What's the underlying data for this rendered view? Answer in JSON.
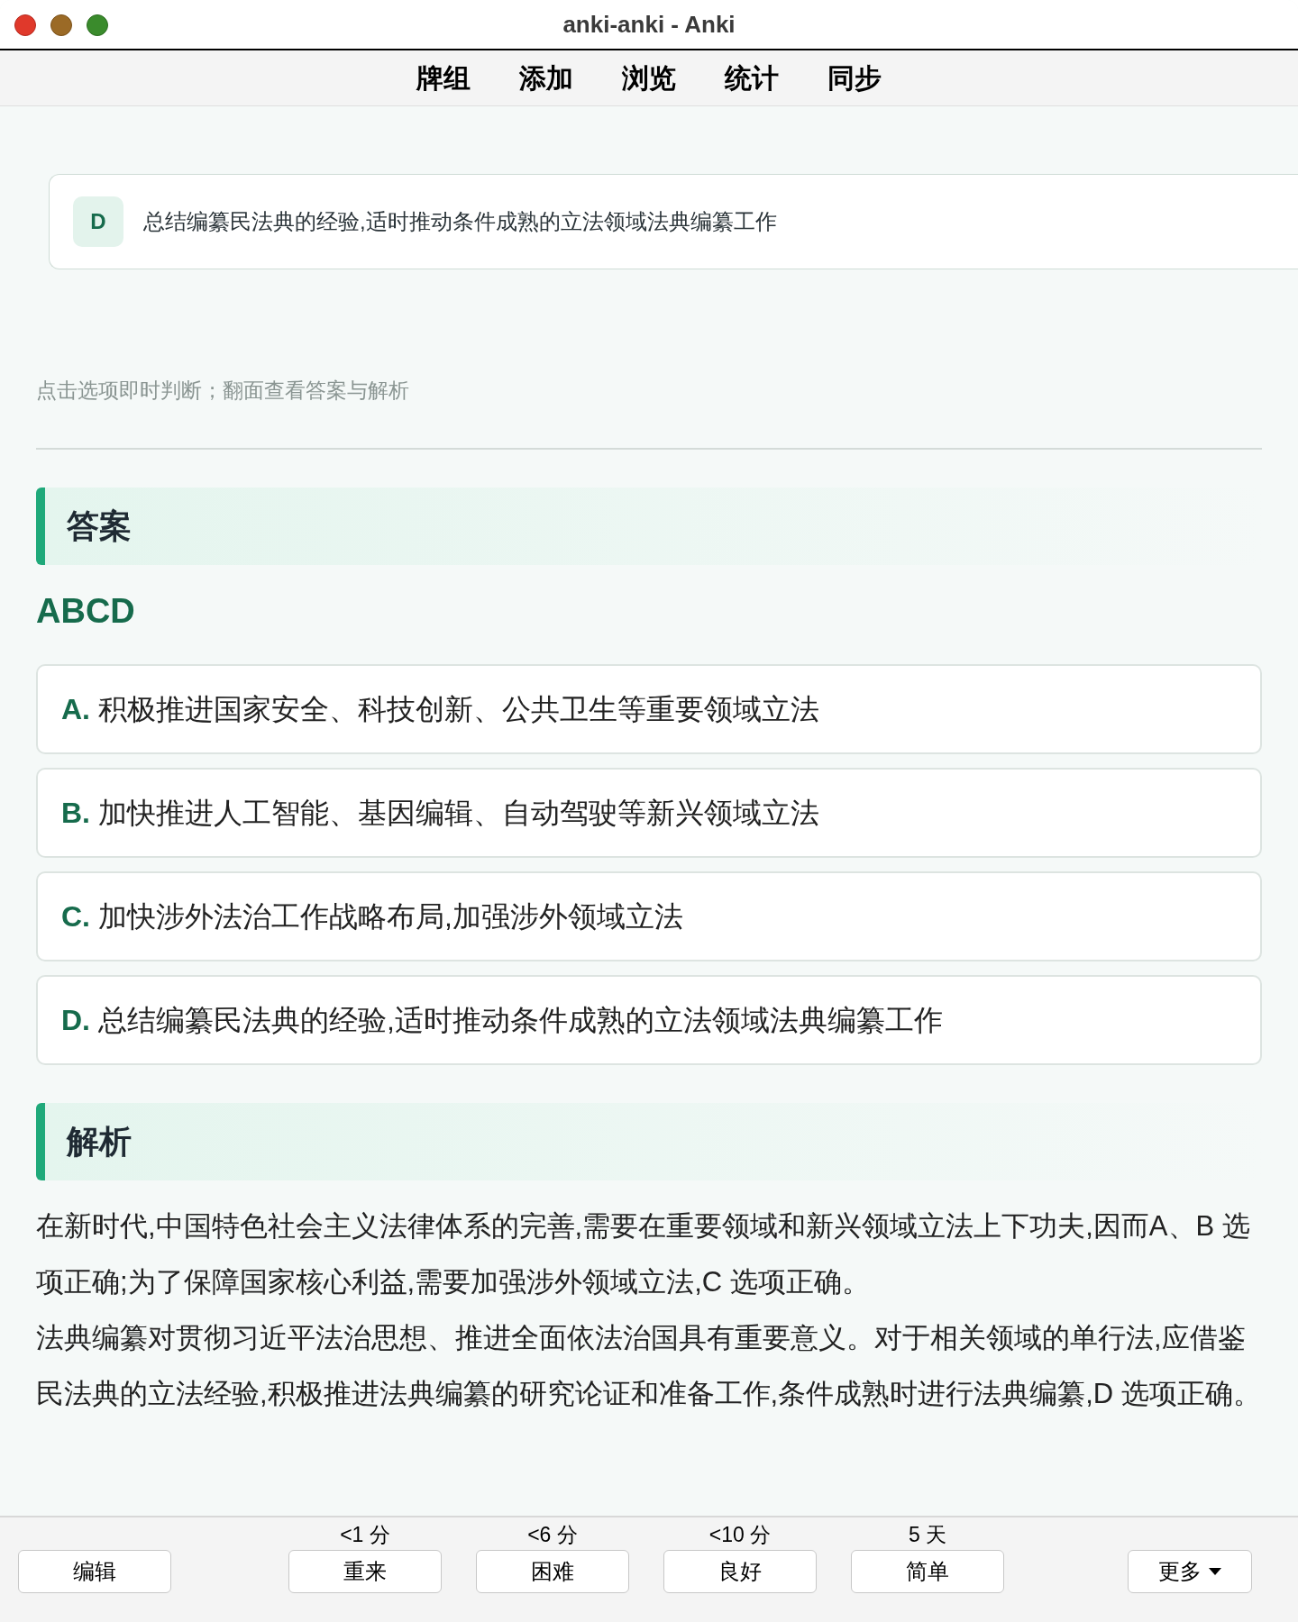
{
  "window": {
    "title": "anki-anki - Anki"
  },
  "nav": [
    "牌组",
    "添加",
    "浏览",
    "统计",
    "同步"
  ],
  "question_option": {
    "letter": "D",
    "text": "总结编纂民法典的经验,适时推动条件成熟的立法领域法典编纂工作"
  },
  "hint": "点击选项即时判断；翻面查看答案与解析",
  "answer": {
    "heading": "答案",
    "value": "ABCD",
    "options": [
      {
        "letter": "A.",
        "text": "积极推进国家安全、科技创新、公共卫生等重要领域立法"
      },
      {
        "letter": "B.",
        "text": "加快推进人工智能、基因编辑、自动驾驶等新兴领域立法"
      },
      {
        "letter": "C.",
        "text": "加快涉外法治工作战略布局,加强涉外领域立法"
      },
      {
        "letter": "D.",
        "text": "总结编纂民法典的经验,适时推动条件成熟的立法领域法典编纂工作"
      }
    ]
  },
  "explanation": {
    "heading": "解析",
    "paragraphs": [
      "在新时代,中国特色社会主义法律体系的完善,需要在重要领域和新兴领域立法上下功夫,因而A、B 选项正确;为了保障国家核心利益,需要加强涉外领域立法,C 选项正确。",
      "法典编纂对贯彻习近平法治思想、推进全面依法治国具有重要意义。对于相关领域的单行法,应借鉴民法典的立法经验,积极推进法典编纂的研究论证和准备工作,条件成熟时进行法典编纂,D 选项正确。"
    ]
  },
  "bottom_bar": {
    "edit": "编辑",
    "ease": [
      {
        "interval": "<1 分",
        "label": "重来"
      },
      {
        "interval": "<6 分",
        "label": "困难"
      },
      {
        "interval": "<10 分",
        "label": "良好"
      },
      {
        "interval": "5 天",
        "label": "简单"
      }
    ],
    "more": "更多"
  }
}
